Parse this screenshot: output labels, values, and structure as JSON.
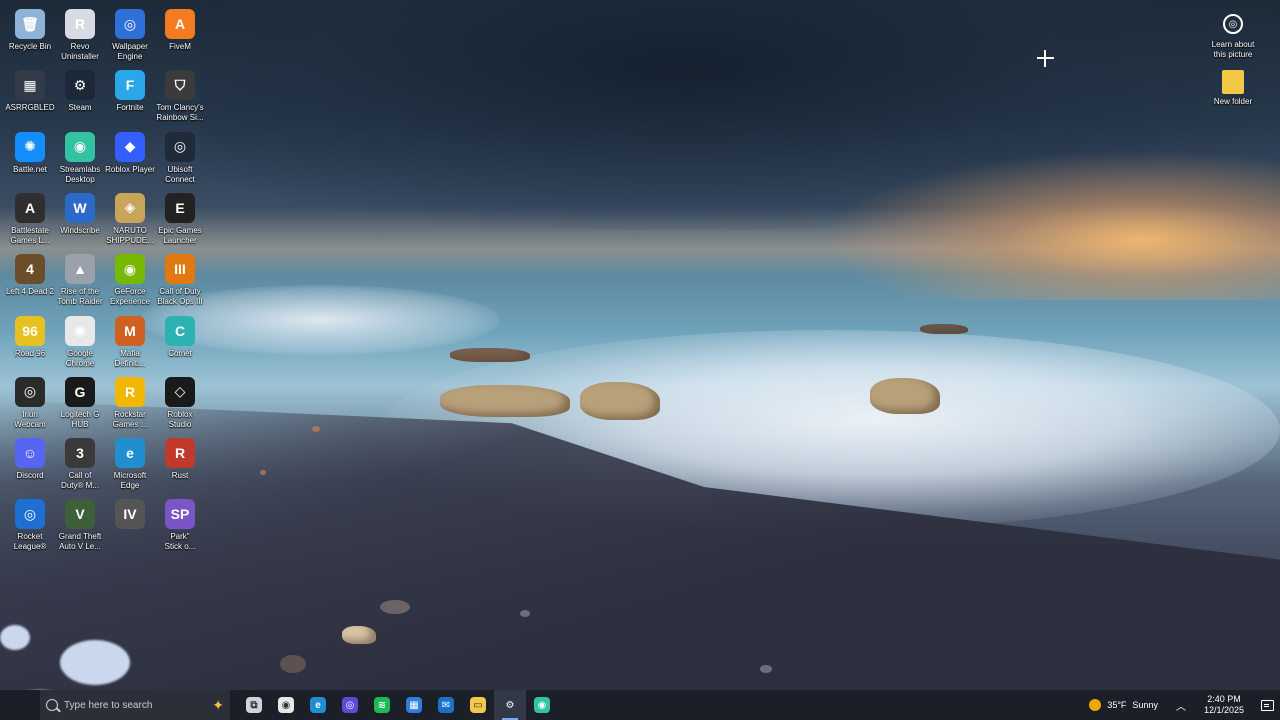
{
  "desktop": {
    "icons_left": [
      {
        "label": "Recycle Bin",
        "icon": "recycle-bin-icon",
        "color": "#8fb3d9",
        "glyph": "🗑"
      },
      {
        "label": "Revo\nUninstaller",
        "icon": "revo-icon",
        "color": "#d8dbe3",
        "glyph": "R"
      },
      {
        "label": "Wallpaper\nEngine",
        "icon": "wallpaper-engine-icon",
        "color": "#2f6fd8",
        "glyph": "◎"
      },
      {
        "label": "FiveM",
        "icon": "fivem-icon",
        "color": "#f47c20",
        "glyph": "A"
      },
      {
        "label": "ASRRGBLED",
        "icon": "asrrgbled-icon",
        "color": "#333a48",
        "glyph": "▦"
      },
      {
        "label": "Steam",
        "icon": "steam-icon",
        "color": "#1b2838",
        "glyph": "⚙"
      },
      {
        "label": "Fortnite",
        "icon": "fortnite-icon",
        "color": "#2aa7e8",
        "glyph": "F"
      },
      {
        "label": "Tom Clancy's\nRainbow Si...",
        "icon": "rainbow-six-icon",
        "color": "#3b3b3b",
        "glyph": "⛉"
      },
      {
        "label": "Battle.net",
        "icon": "battlenet-icon",
        "color": "#148eff",
        "glyph": "✺"
      },
      {
        "label": "Streamlabs\nDesktop",
        "icon": "streamlabs-icon",
        "color": "#31c3a2",
        "glyph": "◉"
      },
      {
        "label": "Roblox Player",
        "icon": "roblox-player-icon",
        "color": "#335fff",
        "glyph": "◆"
      },
      {
        "label": "Ubisoft\nConnect",
        "icon": "ubisoft-icon",
        "color": "#1f2a3a",
        "glyph": "◎"
      },
      {
        "label": "Battlestate\nGames L...",
        "icon": "battlestate-icon",
        "color": "#2f2f2f",
        "glyph": "A"
      },
      {
        "label": "Windscribe",
        "icon": "windscribe-icon",
        "color": "#2c69c8",
        "glyph": "W"
      },
      {
        "label": "NARUTO\nSHIPPUDE...",
        "icon": "naruto-icon",
        "color": "#c9a45b",
        "glyph": "◈"
      },
      {
        "label": "Epic Games\nLauncher",
        "icon": "epic-games-icon",
        "color": "#222222",
        "glyph": "E"
      },
      {
        "label": "Left 4 Dead 2",
        "icon": "l4d2-icon",
        "color": "#6b4d2a",
        "glyph": "4"
      },
      {
        "label": "Rise of the\nTomb Raider",
        "icon": "tomb-raider-icon",
        "color": "#9aa1aa",
        "glyph": "▲"
      },
      {
        "label": "GeForce\nExperience",
        "icon": "geforce-icon",
        "color": "#76b900",
        "glyph": "◉"
      },
      {
        "label": "Call of Duty\nBlack Ops III",
        "icon": "cod-bo3-icon",
        "color": "#e07a10",
        "glyph": "III"
      },
      {
        "label": "Road 96",
        "icon": "road96-icon",
        "color": "#e6c220",
        "glyph": "96"
      },
      {
        "label": "Google\nChrome",
        "icon": "chrome-icon",
        "color": "#e8e8e8",
        "glyph": "◉"
      },
      {
        "label": "Mafia\nDefiniti...",
        "icon": "mafia-icon",
        "color": "#d06020",
        "glyph": "M"
      },
      {
        "label": "Comet",
        "icon": "comet-icon",
        "color": "#2bb3b1",
        "glyph": "C"
      },
      {
        "label": "Iriun\nWebcam",
        "icon": "iriun-icon",
        "color": "#2b2b2b",
        "glyph": "◎"
      },
      {
        "label": "Logitech G\nHUB",
        "icon": "logitech-icon",
        "color": "#1a1a1a",
        "glyph": "G"
      },
      {
        "label": "Rockstar\nGames ...",
        "icon": "rockstar-icon",
        "color": "#f2b705",
        "glyph": "R"
      },
      {
        "label": "Roblox\nStudio",
        "icon": "roblox-studio-icon",
        "color": "#1a1a1a",
        "glyph": "◇"
      },
      {
        "label": "Discord",
        "icon": "discord-icon",
        "color": "#5865f2",
        "glyph": "☺"
      },
      {
        "label": "Call of\nDuty® M...",
        "icon": "cod-mw-icon",
        "color": "#3a3a3a",
        "glyph": "3"
      },
      {
        "label": "Microsoft\nEdge",
        "icon": "edge-icon",
        "color": "#1f8fcf",
        "glyph": "e"
      },
      {
        "label": "Rust",
        "icon": "rust-icon",
        "color": "#c0392b",
        "glyph": "R"
      },
      {
        "label": "Rocket\nLeague®",
        "icon": "rocket-league-icon",
        "color": "#1d6fd1",
        "glyph": "◎"
      },
      {
        "label": "Grand Theft\nAuto V Le...",
        "icon": "gta5-icon",
        "color": "#3d5f3a",
        "glyph": "V"
      },
      {
        "label": "",
        "icon": "gta4-icon",
        "color": "#555555",
        "glyph": "IV"
      },
      {
        "label": "Park\"\nStick o...",
        "icon": "south-park-icon",
        "color": "#7a55c8",
        "glyph": "SP"
      }
    ],
    "icons_right": [
      {
        "label": "Learn about\nthis picture",
        "icon": "learn-about-picture-icon",
        "color": "transparent",
        "glyph": "◎"
      },
      {
        "label": "New folder",
        "icon": "folder-icon",
        "color": "#f3c848",
        "glyph": ""
      }
    ]
  },
  "taskbar": {
    "search_placeholder": "Type here to search",
    "apps": [
      {
        "name": "task-view",
        "icon": "task-view-icon",
        "color": "#cfd3da",
        "glyph": "⧉"
      },
      {
        "name": "chrome",
        "icon": "chrome-icon",
        "color": "#e8e8e8",
        "glyph": "◉"
      },
      {
        "name": "edge",
        "icon": "edge-icon",
        "color": "#1f8fcf",
        "glyph": "e"
      },
      {
        "name": "comet",
        "icon": "comet-icon",
        "color": "#5b4bd6",
        "glyph": "◎"
      },
      {
        "name": "spotify",
        "icon": "spotify-icon",
        "color": "#1db954",
        "glyph": "≋"
      },
      {
        "name": "store",
        "icon": "microsoft-store-icon",
        "color": "#2f7de1",
        "glyph": "▦"
      },
      {
        "name": "mail",
        "icon": "mail-icon",
        "color": "#1a73c8",
        "glyph": "✉"
      },
      {
        "name": "file-explorer",
        "icon": "file-explorer-icon",
        "color": "#f3c848",
        "glyph": "▭"
      },
      {
        "name": "settings",
        "icon": "settings-icon",
        "color": "transparent",
        "glyph": "⚙"
      },
      {
        "name": "streamlabs",
        "icon": "streamlabs-icon",
        "color": "#31c3a2",
        "glyph": "◉"
      }
    ],
    "active_app_index": 8,
    "weather": {
      "temp": "35°F",
      "condition": "Sunny"
    },
    "time": "2:40 PM",
    "date": "12/1/2025"
  }
}
